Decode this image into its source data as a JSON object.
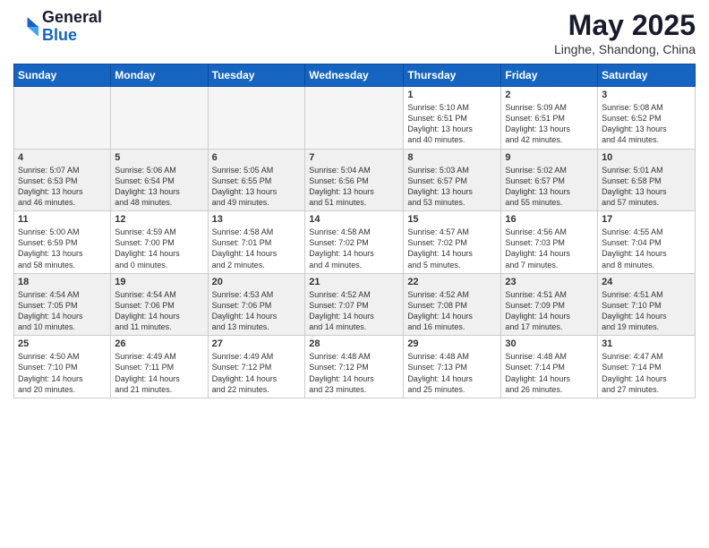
{
  "logo": {
    "general": "General",
    "blue": "Blue"
  },
  "title": {
    "month": "May 2025",
    "location": "Linghe, Shandong, China"
  },
  "days": [
    "Sunday",
    "Monday",
    "Tuesday",
    "Wednesday",
    "Thursday",
    "Friday",
    "Saturday"
  ],
  "weeks": [
    [
      {
        "day": "",
        "content": ""
      },
      {
        "day": "",
        "content": ""
      },
      {
        "day": "",
        "content": ""
      },
      {
        "day": "",
        "content": ""
      },
      {
        "day": "1",
        "content": "Sunrise: 5:10 AM\nSunset: 6:51 PM\nDaylight: 13 hours\nand 40 minutes."
      },
      {
        "day": "2",
        "content": "Sunrise: 5:09 AM\nSunset: 6:51 PM\nDaylight: 13 hours\nand 42 minutes."
      },
      {
        "day": "3",
        "content": "Sunrise: 5:08 AM\nSunset: 6:52 PM\nDaylight: 13 hours\nand 44 minutes."
      }
    ],
    [
      {
        "day": "4",
        "content": "Sunrise: 5:07 AM\nSunset: 6:53 PM\nDaylight: 13 hours\nand 46 minutes."
      },
      {
        "day": "5",
        "content": "Sunrise: 5:06 AM\nSunset: 6:54 PM\nDaylight: 13 hours\nand 48 minutes."
      },
      {
        "day": "6",
        "content": "Sunrise: 5:05 AM\nSunset: 6:55 PM\nDaylight: 13 hours\nand 49 minutes."
      },
      {
        "day": "7",
        "content": "Sunrise: 5:04 AM\nSunset: 6:56 PM\nDaylight: 13 hours\nand 51 minutes."
      },
      {
        "day": "8",
        "content": "Sunrise: 5:03 AM\nSunset: 6:57 PM\nDaylight: 13 hours\nand 53 minutes."
      },
      {
        "day": "9",
        "content": "Sunrise: 5:02 AM\nSunset: 6:57 PM\nDaylight: 13 hours\nand 55 minutes."
      },
      {
        "day": "10",
        "content": "Sunrise: 5:01 AM\nSunset: 6:58 PM\nDaylight: 13 hours\nand 57 minutes."
      }
    ],
    [
      {
        "day": "11",
        "content": "Sunrise: 5:00 AM\nSunset: 6:59 PM\nDaylight: 13 hours\nand 58 minutes."
      },
      {
        "day": "12",
        "content": "Sunrise: 4:59 AM\nSunset: 7:00 PM\nDaylight: 14 hours\nand 0 minutes."
      },
      {
        "day": "13",
        "content": "Sunrise: 4:58 AM\nSunset: 7:01 PM\nDaylight: 14 hours\nand 2 minutes."
      },
      {
        "day": "14",
        "content": "Sunrise: 4:58 AM\nSunset: 7:02 PM\nDaylight: 14 hours\nand 4 minutes."
      },
      {
        "day": "15",
        "content": "Sunrise: 4:57 AM\nSunset: 7:02 PM\nDaylight: 14 hours\nand 5 minutes."
      },
      {
        "day": "16",
        "content": "Sunrise: 4:56 AM\nSunset: 7:03 PM\nDaylight: 14 hours\nand 7 minutes."
      },
      {
        "day": "17",
        "content": "Sunrise: 4:55 AM\nSunset: 7:04 PM\nDaylight: 14 hours\nand 8 minutes."
      }
    ],
    [
      {
        "day": "18",
        "content": "Sunrise: 4:54 AM\nSunset: 7:05 PM\nDaylight: 14 hours\nand 10 minutes."
      },
      {
        "day": "19",
        "content": "Sunrise: 4:54 AM\nSunset: 7:06 PM\nDaylight: 14 hours\nand 11 minutes."
      },
      {
        "day": "20",
        "content": "Sunrise: 4:53 AM\nSunset: 7:06 PM\nDaylight: 14 hours\nand 13 minutes."
      },
      {
        "day": "21",
        "content": "Sunrise: 4:52 AM\nSunset: 7:07 PM\nDaylight: 14 hours\nand 14 minutes."
      },
      {
        "day": "22",
        "content": "Sunrise: 4:52 AM\nSunset: 7:08 PM\nDaylight: 14 hours\nand 16 minutes."
      },
      {
        "day": "23",
        "content": "Sunrise: 4:51 AM\nSunset: 7:09 PM\nDaylight: 14 hours\nand 17 minutes."
      },
      {
        "day": "24",
        "content": "Sunrise: 4:51 AM\nSunset: 7:10 PM\nDaylight: 14 hours\nand 19 minutes."
      }
    ],
    [
      {
        "day": "25",
        "content": "Sunrise: 4:50 AM\nSunset: 7:10 PM\nDaylight: 14 hours\nand 20 minutes."
      },
      {
        "day": "26",
        "content": "Sunrise: 4:49 AM\nSunset: 7:11 PM\nDaylight: 14 hours\nand 21 minutes."
      },
      {
        "day": "27",
        "content": "Sunrise: 4:49 AM\nSunset: 7:12 PM\nDaylight: 14 hours\nand 22 minutes."
      },
      {
        "day": "28",
        "content": "Sunrise: 4:48 AM\nSunset: 7:12 PM\nDaylight: 14 hours\nand 23 minutes."
      },
      {
        "day": "29",
        "content": "Sunrise: 4:48 AM\nSunset: 7:13 PM\nDaylight: 14 hours\nand 25 minutes."
      },
      {
        "day": "30",
        "content": "Sunrise: 4:48 AM\nSunset: 7:14 PM\nDaylight: 14 hours\nand 26 minutes."
      },
      {
        "day": "31",
        "content": "Sunrise: 4:47 AM\nSunset: 7:14 PM\nDaylight: 14 hours\nand 27 minutes."
      }
    ]
  ]
}
